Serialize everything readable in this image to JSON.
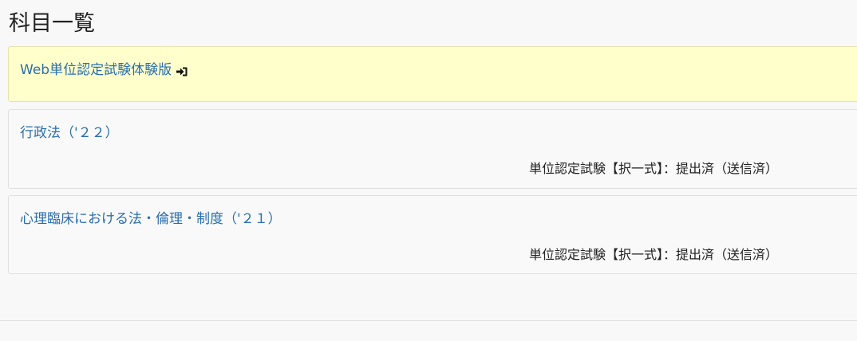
{
  "page": {
    "title": "科目一覧"
  },
  "courses": [
    {
      "name": "Web単位認定試験体験版",
      "icon": "sign-in-icon",
      "highlight_color": "#ffffcc"
    },
    {
      "name": "行政法（'２２）",
      "status": "単位認定試験【択一式】：提出済（送信済）"
    },
    {
      "name": "心理臨床における法・倫理・制度（'２１）",
      "status": "単位認定試験【択一式】：提出済（送信済）"
    }
  ],
  "colors": {
    "link": "#2a6fb0",
    "background": "#f8f8f8"
  }
}
